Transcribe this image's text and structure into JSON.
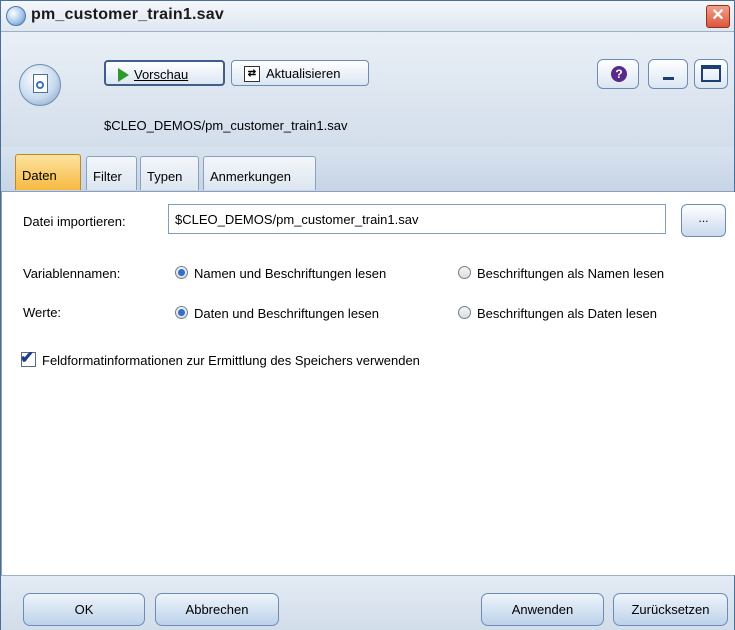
{
  "window": {
    "title": "pm_customer_train1.sav"
  },
  "toolbar": {
    "preview_label": "Vorschau",
    "refresh_label": "Aktualisieren",
    "help_glyph": "?"
  },
  "node": {
    "path": "$CLEO_DEMOS/pm_customer_train1.sav"
  },
  "tabs": [
    {
      "label": "Daten",
      "active": true
    },
    {
      "label": "Filter",
      "active": false
    },
    {
      "label": "Typen",
      "active": false
    },
    {
      "label": "Anmerkungen",
      "active": false
    }
  ],
  "form": {
    "import_label": "Datei importieren:",
    "import_value": "$CLEO_DEMOS/pm_customer_train1.sav",
    "browse_label": "...",
    "varnames_label": "Variablennamen:",
    "varnames_opt1": "Namen und Beschriftungen lesen",
    "varnames_opt2": "Beschriftungen als Namen lesen",
    "values_label": "Werte:",
    "values_opt1": "Daten und Beschriftungen lesen",
    "values_opt2": "Beschriftungen als Daten lesen",
    "format_checkbox_label": "Feldformatinformationen zur Ermittlung des Speichers verwenden",
    "format_checkbox_checked": true
  },
  "footer": {
    "ok": "OK",
    "cancel": "Abbrechen",
    "apply": "Anwenden",
    "reset": "Zurücksetzen"
  }
}
